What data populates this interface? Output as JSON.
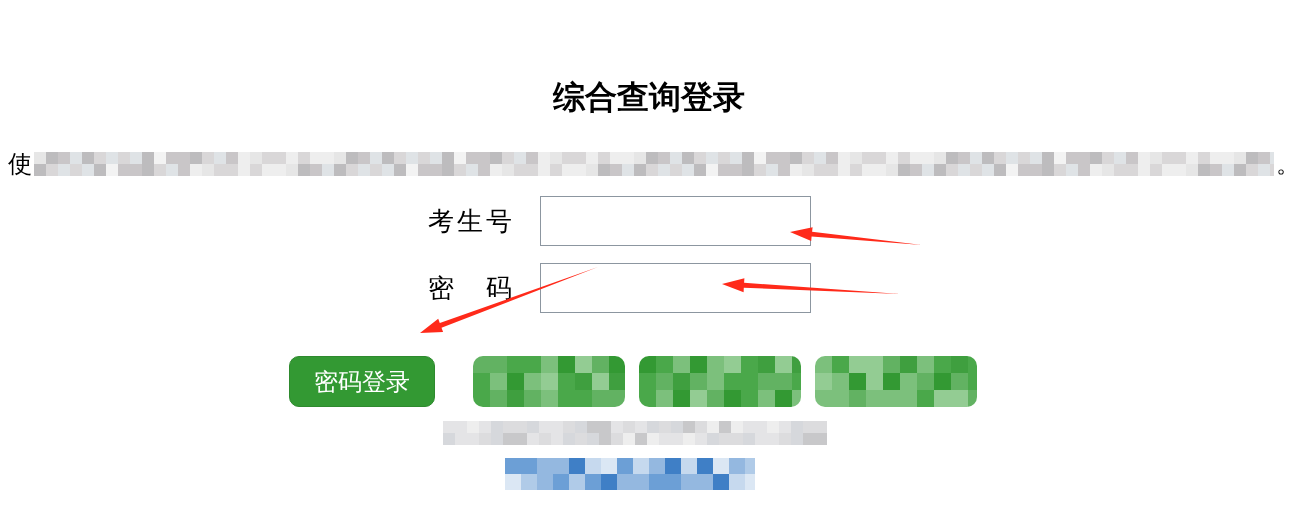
{
  "title": "综合查询登录",
  "intro": {
    "start": "使",
    "end": "。"
  },
  "fields": [
    {
      "label": "考生号"
    },
    {
      "label": "密　码"
    }
  ],
  "buttons": [
    {
      "kind": "button",
      "label": "密码登录"
    },
    {
      "kind": "redacted"
    },
    {
      "kind": "redacted"
    },
    {
      "kind": "redacted"
    }
  ],
  "redacted_lines": [
    {
      "kind": "text"
    },
    {
      "kind": "link"
    }
  ],
  "annotations": [
    {
      "kind": "arrow"
    },
    {
      "kind": "arrow"
    },
    {
      "kind": "arrow"
    }
  ]
}
